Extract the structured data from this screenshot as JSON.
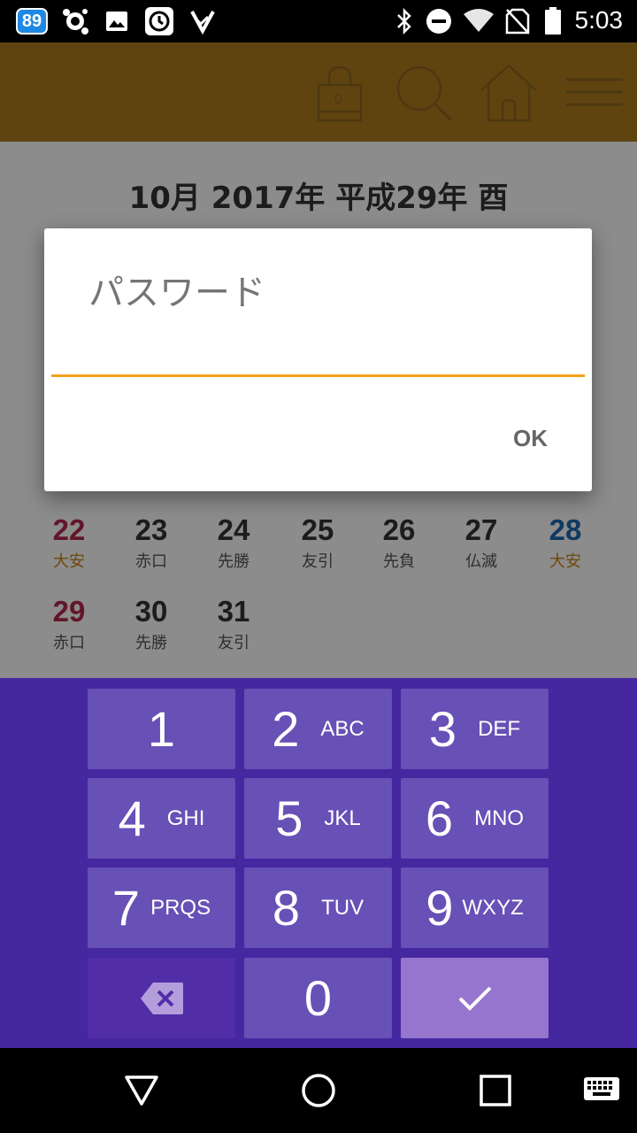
{
  "status_bar": {
    "badge": "89",
    "time": "5:03",
    "left_icons": [
      "badge-89-icon",
      "avast-icon",
      "image-icon",
      "history-icon",
      "checklist-icon"
    ],
    "right_icons": [
      "bluetooth-icon",
      "do-not-disturb-icon",
      "wifi-icon",
      "no-sim-icon",
      "battery-icon"
    ]
  },
  "app_bar": {
    "lock_count": "0",
    "icons": [
      "lock-icon",
      "search-icon",
      "home-icon",
      "menu-icon"
    ],
    "color": "#b07d1e"
  },
  "calendar": {
    "title": "10月 2017年 平成29年 酉",
    "rows": [
      [
        {
          "num": "22",
          "rokuyo": "大安",
          "numColor": "#b5284d",
          "rkColor": "#c98316"
        },
        {
          "num": "23",
          "rokuyo": "赤口",
          "numColor": "#333333",
          "rkColor": "#555555"
        },
        {
          "num": "24",
          "rokuyo": "先勝",
          "numColor": "#333333",
          "rkColor": "#555555"
        },
        {
          "num": "25",
          "rokuyo": "友引",
          "numColor": "#333333",
          "rkColor": "#555555"
        },
        {
          "num": "26",
          "rokuyo": "先負",
          "numColor": "#333333",
          "rkColor": "#555555"
        },
        {
          "num": "27",
          "rokuyo": "仏滅",
          "numColor": "#333333",
          "rkColor": "#555555"
        },
        {
          "num": "28",
          "rokuyo": "大安",
          "numColor": "#1e6bb0",
          "rkColor": "#c98316"
        }
      ],
      [
        {
          "num": "29",
          "rokuyo": "赤口",
          "numColor": "#b5284d",
          "rkColor": "#555555"
        },
        {
          "num": "30",
          "rokuyo": "先勝",
          "numColor": "#333333",
          "rkColor": "#555555"
        },
        {
          "num": "31",
          "rokuyo": "友引",
          "numColor": "#333333",
          "rkColor": "#555555"
        }
      ]
    ]
  },
  "dialog": {
    "title": "パスワード",
    "input_value": "",
    "ok_label": "OK",
    "underline_color": "#f2a21b"
  },
  "keypad": {
    "keys": [
      {
        "num": "1",
        "letters": ""
      },
      {
        "num": "2",
        "letters": "ABC"
      },
      {
        "num": "3",
        "letters": "DEF"
      },
      {
        "num": "4",
        "letters": "GHI"
      },
      {
        "num": "5",
        "letters": "JKL"
      },
      {
        "num": "6",
        "letters": "MNO"
      },
      {
        "num": "7",
        "letters": "PRQS"
      },
      {
        "num": "8",
        "letters": "TUV"
      },
      {
        "num": "9",
        "letters": "WXYZ"
      },
      {
        "num": "0",
        "letters": ""
      }
    ],
    "background": "#4527a0"
  },
  "nav_bar": {
    "icons": [
      "back-icon",
      "home-circle-icon",
      "recents-icon",
      "keyboard-icon"
    ]
  }
}
